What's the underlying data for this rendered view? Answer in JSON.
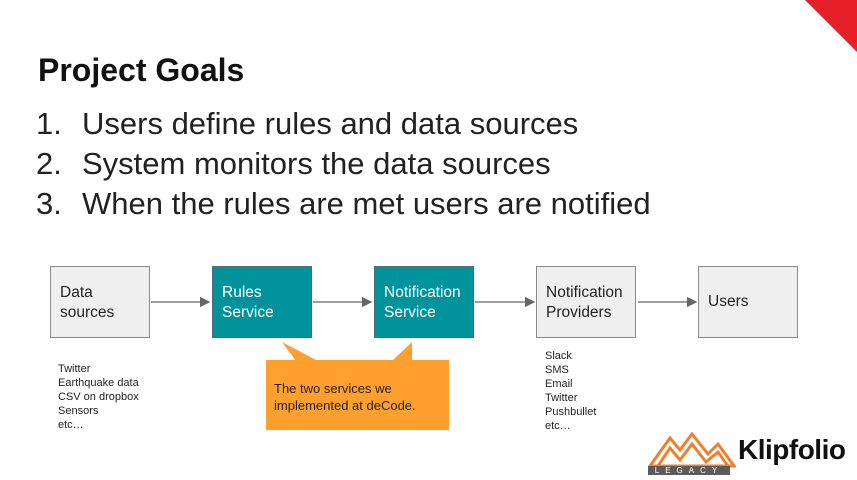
{
  "slide": {
    "title": "Project Goals",
    "goals": [
      {
        "num": "1.",
        "text": "Users define rules and data sources"
      },
      {
        "num": "2.",
        "text": "System monitors the data sources"
      },
      {
        "num": "3.",
        "text": "When the rules are met users are notified"
      }
    ]
  },
  "diagram": {
    "boxes": [
      {
        "line1": "Data",
        "line2": "sources"
      },
      {
        "line1": "Rules",
        "line2": "Service"
      },
      {
        "line1": "Notification",
        "line2": "Service"
      },
      {
        "line1": "Notification",
        "line2": "Providers"
      },
      {
        "line1": "Users",
        "line2": ""
      }
    ],
    "data_sources_list": [
      "Twitter",
      "Earthquake data",
      "CSV on dropbox",
      "Sensors",
      "etc…"
    ],
    "providers_list": [
      "Slack",
      "SMS",
      "Email",
      "Twitter",
      "Pushbullet",
      "etc…"
    ],
    "callout": "The two services we implemented at deCode."
  },
  "logo": {
    "name": "Klipfolio",
    "tag": "LEGACY"
  },
  "colors": {
    "accent_red": "#e8202a",
    "teal": "#00939c",
    "callout_orange": "#ff9f2e",
    "box_gray": "#efefef"
  }
}
